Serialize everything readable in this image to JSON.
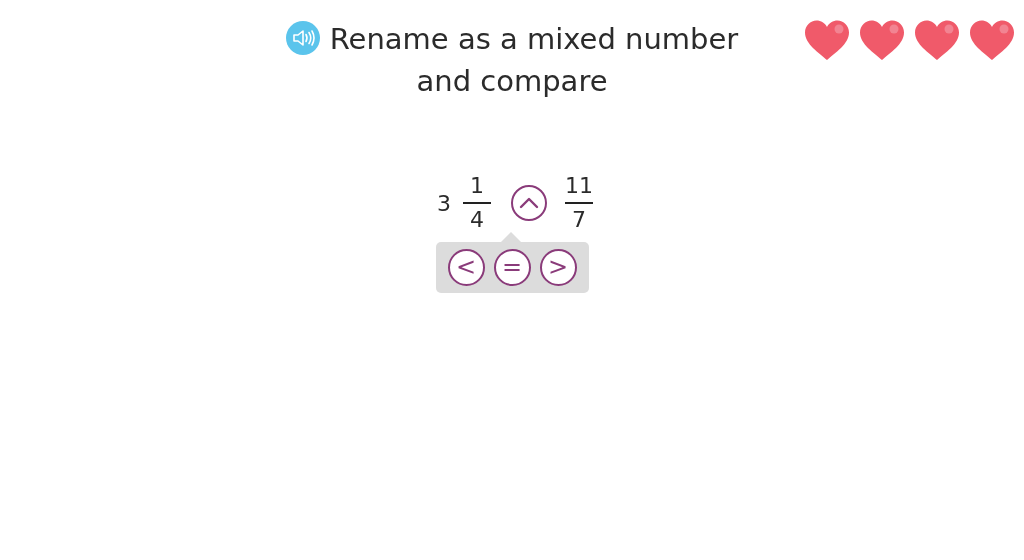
{
  "title": "Rename as a mixed number and compare",
  "hearts": [
    {
      "filled": true
    },
    {
      "filled": true
    },
    {
      "filled": true
    },
    {
      "filled": true
    }
  ],
  "left": {
    "whole": "3",
    "numerator": "1",
    "denominator": "4"
  },
  "dropdown": {
    "expanded": true
  },
  "right": {
    "numerator": "11",
    "denominator": "7"
  },
  "options": [
    {
      "symbol": "<",
      "selected": false
    },
    {
      "symbol": "=",
      "selected": false
    },
    {
      "symbol": ">",
      "selected": false
    }
  ]
}
